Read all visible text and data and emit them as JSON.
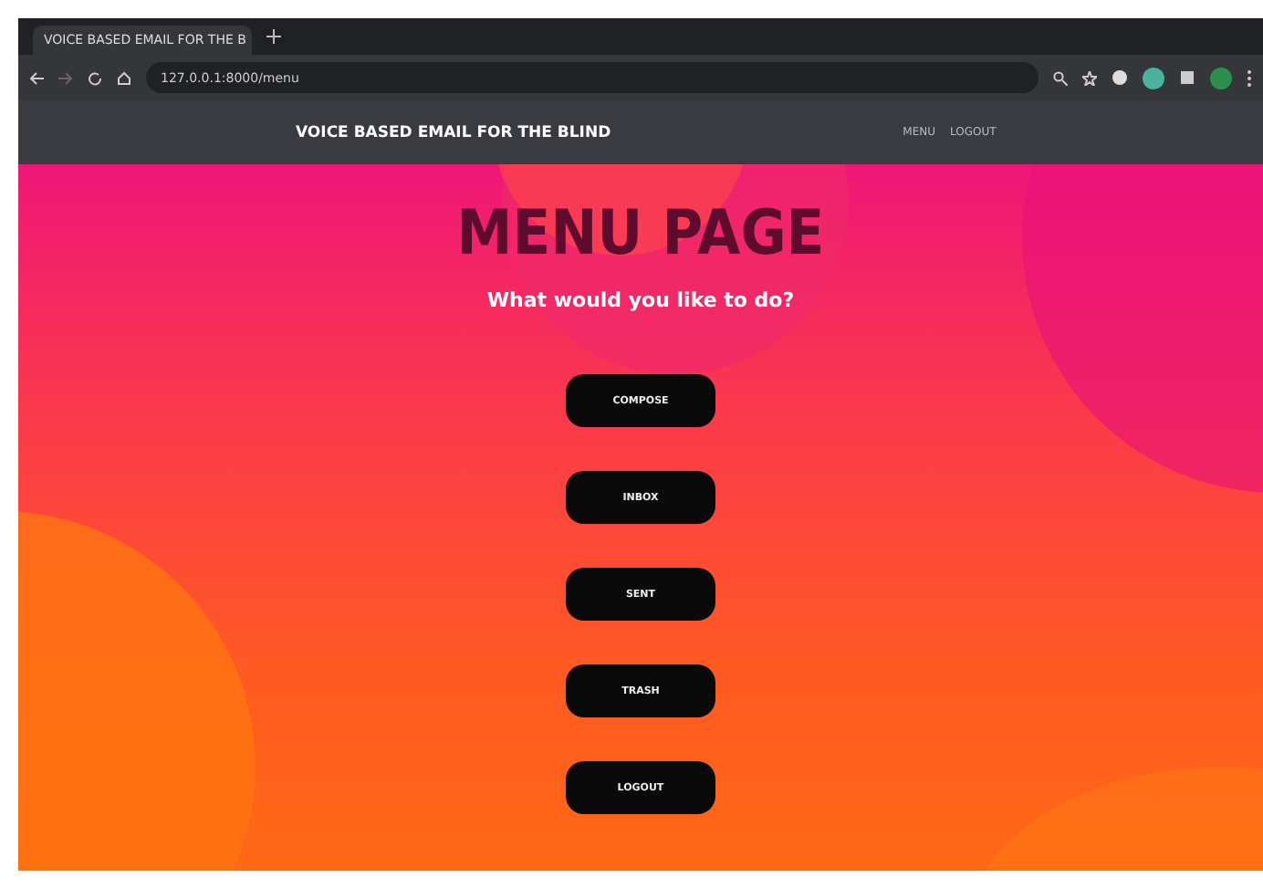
{
  "browser": {
    "tab_title": "VOICE BASED EMAIL FOR THE B",
    "address": "127.0.0.1:8000/menu"
  },
  "header": {
    "title": "VOICE BASED EMAIL FOR THE BLIND",
    "nav": [
      "MENU",
      "LOGOUT"
    ]
  },
  "page": {
    "title": "MENU PAGE",
    "subtitle": "What would you like to do?",
    "buttons": [
      "COMPOSE",
      "INBOX",
      "SENT",
      "TRASH",
      "LOGOUT"
    ]
  }
}
